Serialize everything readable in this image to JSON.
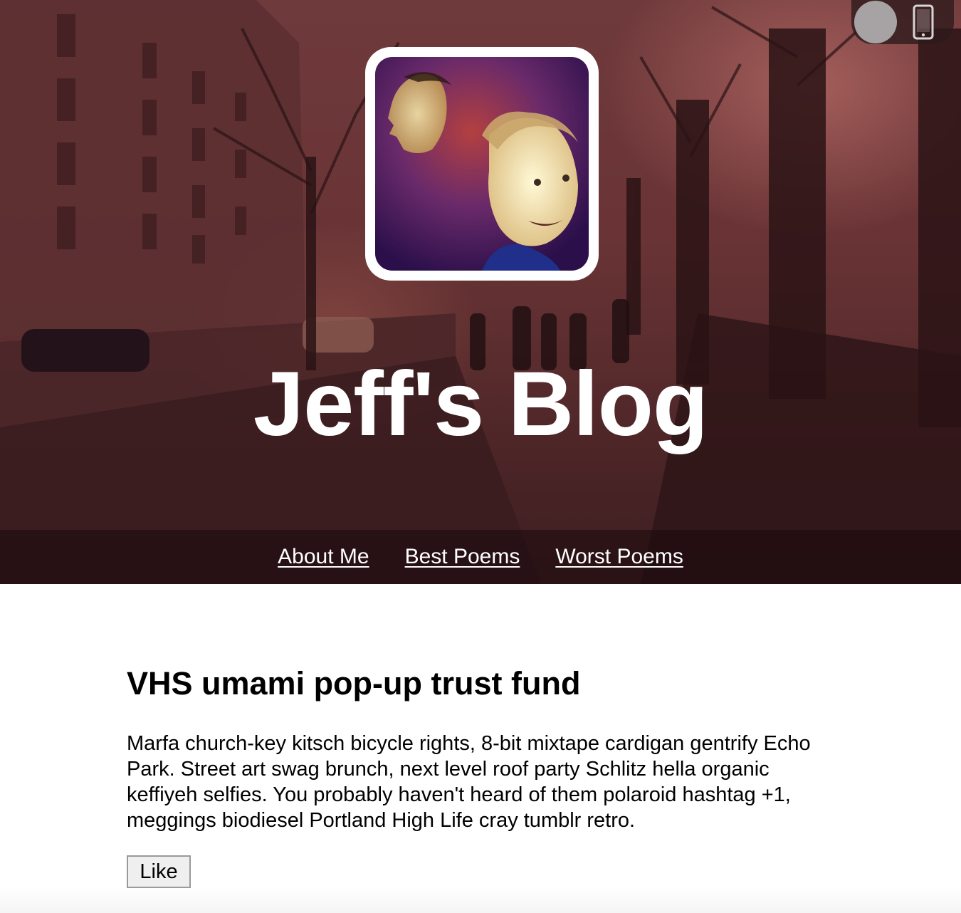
{
  "site": {
    "title": "Jeff's Blog"
  },
  "nav": {
    "items": [
      {
        "label": "About Me"
      },
      {
        "label": "Best Poems"
      },
      {
        "label": "Worst Poems"
      }
    ]
  },
  "post": {
    "title": "VHS umami pop-up trust fund",
    "body": "Marfa church-key kitsch bicycle rights, 8-bit mixtape cardigan gentrify Echo Park. Street art swag brunch, next level roof party Schlitz hella organic keffiyeh selfies. You probably haven't heard of them polaroid hashtag +1, meggings biodiesel Portland High Life cray tumblr retro.",
    "like_label": "Like"
  },
  "icons": {
    "toggle": "toggle-knob",
    "device": "phone-icon"
  },
  "colors": {
    "hero_tint": "#6a3436",
    "nav_bar": "#2a1214",
    "text": "#000000",
    "title": "#ffffff"
  }
}
